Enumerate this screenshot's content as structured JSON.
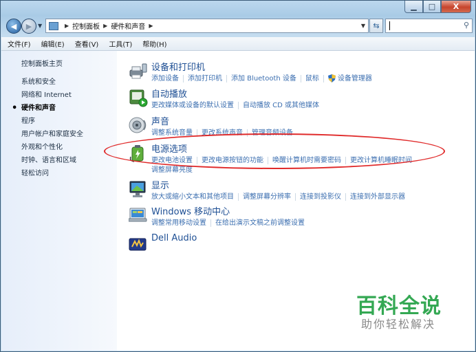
{
  "window": {
    "caption_buttons": {
      "minimize_icon": "minimize-icon",
      "maximize_icon": "maximize-icon",
      "close_label": "X"
    }
  },
  "navigation": {
    "breadcrumbs": [
      "控制面板",
      "硬件和声音"
    ],
    "search_placeholder": ""
  },
  "menubar": {
    "items": [
      "文件(F)",
      "编辑(E)",
      "查看(V)",
      "工具(T)",
      "帮助(H)"
    ]
  },
  "sidebar": {
    "home": "控制面板主页",
    "items": [
      {
        "label": "系统和安全",
        "active": false
      },
      {
        "label": "网络和 Internet",
        "active": false
      },
      {
        "label": "硬件和声音",
        "active": true
      },
      {
        "label": "程序",
        "active": false
      },
      {
        "label": "用户帐户和家庭安全",
        "active": false
      },
      {
        "label": "外观和个性化",
        "active": false
      },
      {
        "label": "时钟、语言和区域",
        "active": false
      },
      {
        "label": "轻松访问",
        "active": false
      }
    ]
  },
  "categories": [
    {
      "title": "设备和打印机",
      "icon": "printer-icon",
      "links": [
        "添加设备",
        "添加打印机",
        "添加 Bluetooth 设备",
        "鼠标",
        "设备管理器"
      ]
    },
    {
      "title": "自动播放",
      "icon": "autoplay-icon",
      "links": [
        "更改媒体或设备的默认设置",
        "自动播放 CD 或其他媒体"
      ]
    },
    {
      "title": "声音",
      "icon": "speaker-icon",
      "links": [
        "调整系统音量",
        "更改系统声音",
        "管理音频设备"
      ]
    },
    {
      "title": "电源选项",
      "icon": "battery-icon",
      "links": [
        "更改电池设置",
        "更改电源按钮的功能",
        "唤醒计算机时需要密码",
        "更改计算机睡眠时间"
      ],
      "links2": [
        "调整屏幕亮度"
      ]
    },
    {
      "title": "显示",
      "icon": "monitor-icon",
      "links": [
        "放大或缩小文本和其他项目",
        "调整屏幕分辨率",
        "连接到投影仪",
        "连接到外部显示器"
      ]
    },
    {
      "title": "Windows 移动中心",
      "icon": "mobility-center-icon",
      "links": [
        "调整常用移动设置",
        "在给出演示文稿之前调整设置"
      ]
    },
    {
      "title": "Dell Audio",
      "icon": "dell-audio-icon",
      "links": []
    }
  ],
  "watermark": {
    "title": "百科全说",
    "subtitle": "助你轻松解决"
  },
  "colors": {
    "link": "#3c6fb0",
    "title": "#1e4f94",
    "annotation": "#e02a2a",
    "watermark_title": "#34a853"
  }
}
